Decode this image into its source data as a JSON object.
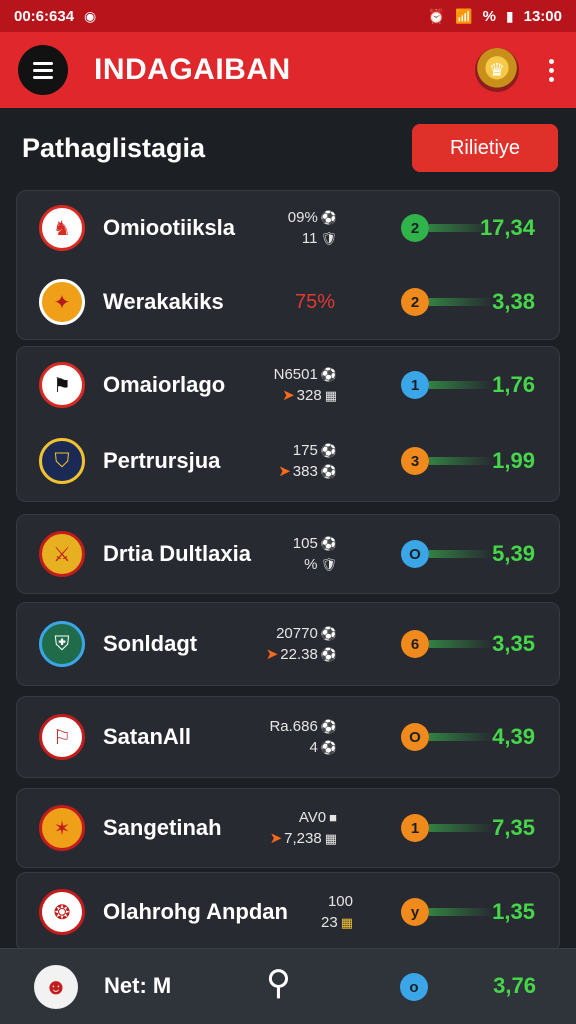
{
  "status_bar": {
    "time_left": "00:6:634",
    "time_right": "13:00",
    "battery": "%"
  },
  "app_bar": {
    "title": "INDAGAIBAN"
  },
  "section": {
    "title": "Pathaglistagia",
    "button_label": "Rilietiye"
  },
  "teams": [
    {
      "name": "Omiootiiksla",
      "stat_top": "09%",
      "stat_bottom": "11",
      "position": "2",
      "pos_color": "#2fb34a",
      "score": "17,34",
      "badge_bg": "#ffffff",
      "badge_fg": "#d62a22",
      "badge_icon": "♞"
    },
    {
      "name": "Werakakiks",
      "pct": "75%",
      "position": "2",
      "pos_color": "#f08a1c",
      "score": "3,38",
      "badge_bg": "#f0a018",
      "badge_fg": "#b31a1a",
      "badge_icon": "✦"
    },
    {
      "name": "Omaiorlago",
      "stat_top": "N6501",
      "stat_bottom": "328",
      "position": "1",
      "pos_color": "#3aa6e8",
      "score": "1,76",
      "badge_bg": "#ffffff",
      "badge_fg": "#111111",
      "badge_icon": "⚑"
    },
    {
      "name": "Pertrursjua",
      "stat_top": "175",
      "stat_bottom": "383",
      "position": "3",
      "pos_color": "#f08a1c",
      "score": "1,99",
      "badge_bg": "#1b2a55",
      "badge_fg": "#f2c230",
      "badge_icon": "⛉"
    },
    {
      "name": "Drtia Dultlaxia",
      "stat_top": "105",
      "stat_bottom": "%",
      "position": "O",
      "pos_color": "#3aa6e8",
      "score": "5,39",
      "badge_bg": "#e6b020",
      "badge_fg": "#c21c1c",
      "badge_icon": "⚔"
    },
    {
      "name": "Sonldagt",
      "stat_top": "20770",
      "stat_bottom": "22.38",
      "position": "6",
      "pos_color": "#f08a1c",
      "score": "3,35",
      "badge_bg": "#1f6b4a",
      "badge_fg": "#ffffff",
      "badge_icon": "⛨"
    },
    {
      "name": "SatanAll",
      "stat_top": "Ra.686",
      "stat_bottom": "4",
      "position": "O",
      "pos_color": "#f08a1c",
      "score": "4,39",
      "badge_bg": "#ffffff",
      "badge_fg": "#c21c1c",
      "badge_icon": "⚐"
    },
    {
      "name": "Sangetinah",
      "stat_top": "AV0",
      "stat_bottom": "7,238",
      "position": "1",
      "pos_color": "#f08a1c",
      "score": "7,35",
      "badge_bg": "#f0a018",
      "badge_fg": "#c21c1c",
      "badge_icon": "✶"
    },
    {
      "name": "Olahrohg Anpdan",
      "stat_top": "100",
      "stat_bottom": "23",
      "position": "y",
      "pos_color": "#f08a1c",
      "score": "1,35",
      "badge_bg": "#ffffff",
      "badge_fg": "#c21c1c",
      "badge_icon": "❂"
    }
  ],
  "bottom_bar": {
    "label": "Net: M",
    "position": "o",
    "score": "3,76"
  }
}
